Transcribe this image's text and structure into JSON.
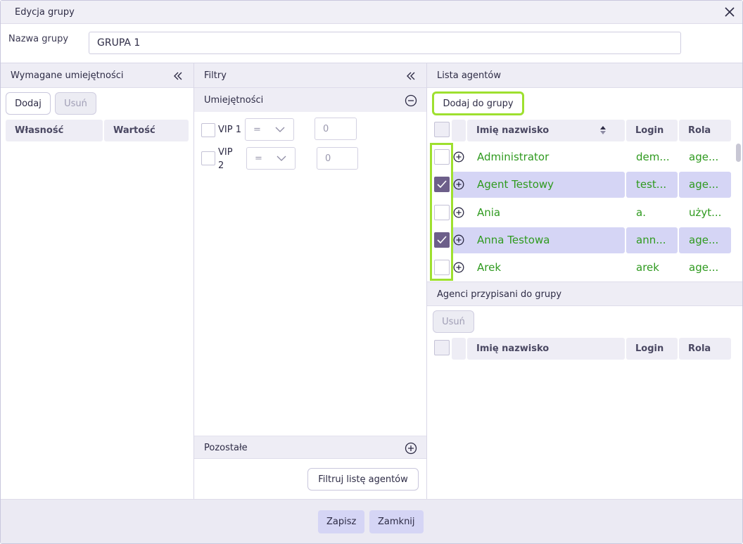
{
  "dialog": {
    "title": "Edycja grupy"
  },
  "group_name": {
    "label": "Nazwa grupy",
    "value": "GRUPA 1"
  },
  "skills_panel": {
    "title": "Wymagane umiejętności",
    "add_label": "Dodaj",
    "remove_label": "Usuń",
    "columns": [
      "Własność",
      "Wartość"
    ]
  },
  "filters_panel": {
    "title": "Filtry",
    "skills_section": "Umiejętności",
    "rows": [
      {
        "label": "VIP 1",
        "operator": "=",
        "value": "0"
      },
      {
        "label": "VIP 2",
        "operator": "=",
        "value": "0"
      }
    ],
    "other_section": "Pozostałe",
    "filter_button": "Filtruj listę agentów"
  },
  "agents_panel": {
    "title": "Lista agentów",
    "add_to_group_label": "Dodaj do grupy",
    "columns": [
      "Imię nazwisko",
      "Login",
      "Rola"
    ],
    "rows": [
      {
        "name": "Administrator",
        "login": "dem...",
        "role": "age...",
        "checked": false
      },
      {
        "name": "Agent Testowy",
        "login": "test...",
        "role": "age...",
        "checked": true
      },
      {
        "name": "Ania",
        "login": "a.",
        "role": "użyt...",
        "checked": false
      },
      {
        "name": "Anna Testowa",
        "login": "ann...",
        "role": "age...",
        "checked": true
      },
      {
        "name": "Arek",
        "login": "arek",
        "role": "age...",
        "checked": false
      }
    ]
  },
  "assigned_panel": {
    "title": "Agenci przypisani do grupy",
    "remove_label": "Usuń",
    "columns": [
      "Imię nazwisko",
      "Login",
      "Rola"
    ]
  },
  "footer": {
    "save_label": "Zapisz",
    "close_label": "Zamknij"
  },
  "colors": {
    "accent": "#9ee02f",
    "highlight_row": "#d5d5f5",
    "agent_text": "#2f9a1f",
    "checkbox_checked": "#6d5f8a"
  }
}
